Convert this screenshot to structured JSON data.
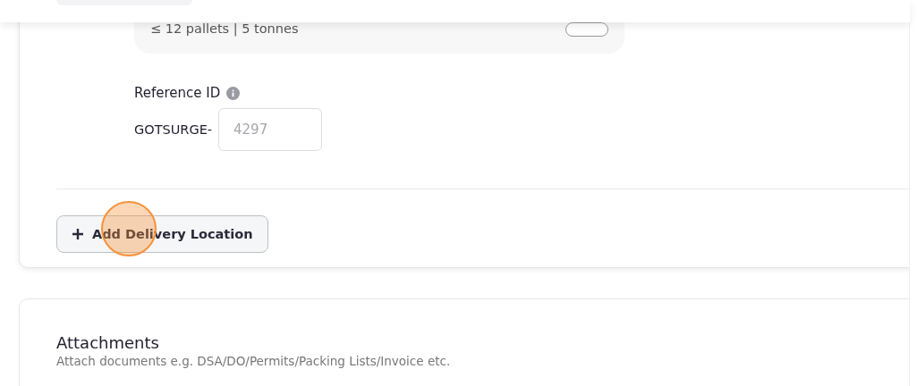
{
  "vehicle_option": {
    "capacity": "≤ 12 pallets | 5 tonnes"
  },
  "reference": {
    "label": "Reference ID",
    "prefix": "GOTSURGE-",
    "placeholder": "4297"
  },
  "add_location_button": {
    "label": "Add Delivery Location"
  },
  "attachments": {
    "title": "Attachments",
    "hint": "Attach documents e.g. DSA/DO/Permits/Packing Lists/Invoice etc."
  }
}
